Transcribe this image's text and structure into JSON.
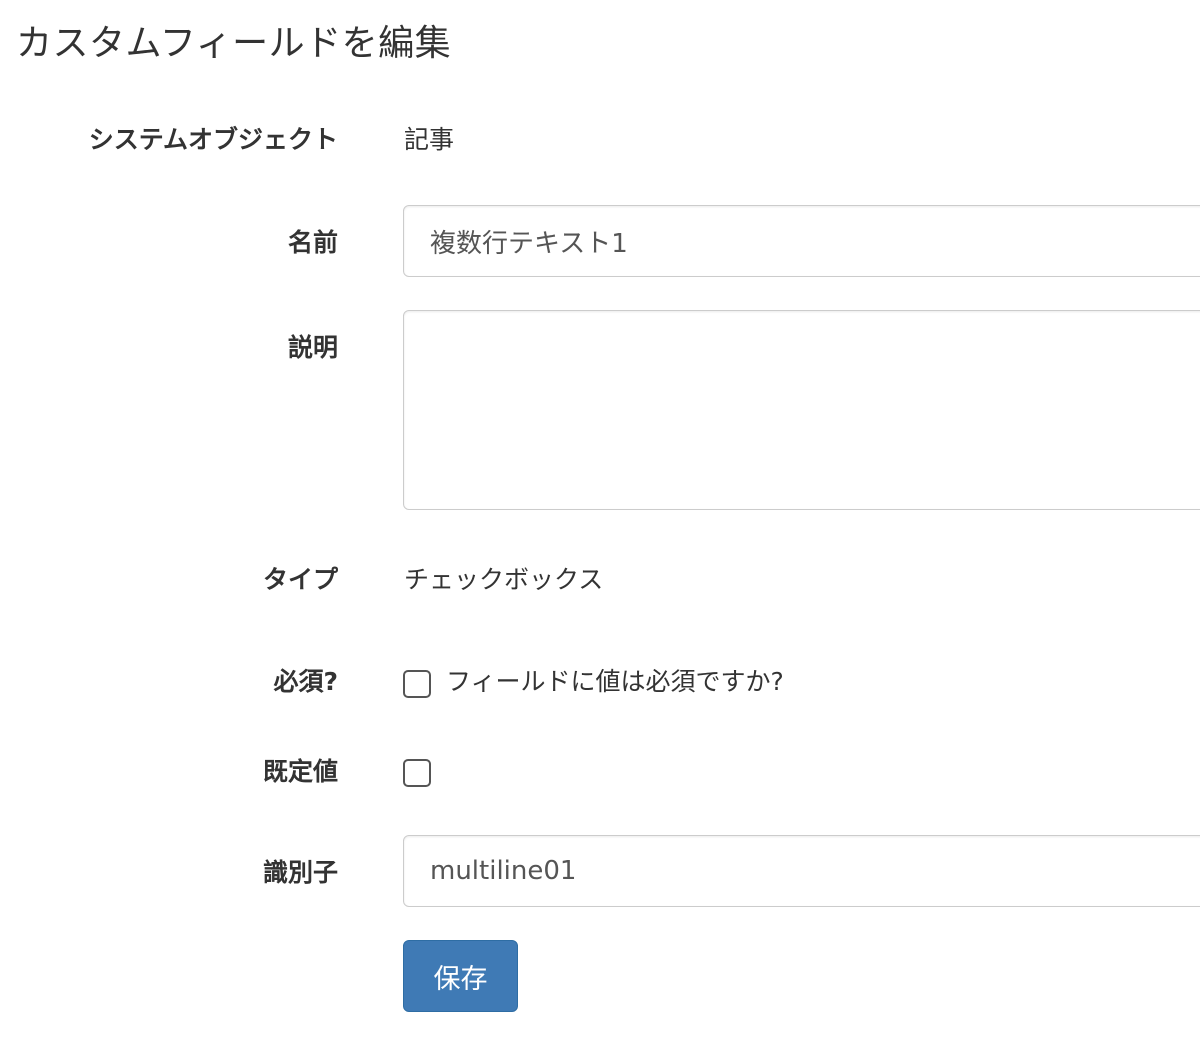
{
  "page": {
    "title": "カスタムフィールドを編集"
  },
  "form": {
    "system_object": {
      "label": "システムオブジェクト",
      "value": "記事"
    },
    "name": {
      "label": "名前",
      "value": "複数行テキスト1"
    },
    "description": {
      "label": "説明",
      "value": ""
    },
    "type": {
      "label": "タイプ",
      "value": "チェックボックス"
    },
    "required": {
      "label": "必須?",
      "checkbox_label": "フィールドに値は必須ですか?",
      "checked": false
    },
    "default_value": {
      "label": "既定値",
      "checked": false
    },
    "identifier": {
      "label": "識別子",
      "value": "multiline01"
    },
    "save_label": "保存"
  },
  "colors": {
    "primary_button": "#3f7ab5",
    "text": "#333333",
    "input_border": "#cccccc"
  }
}
